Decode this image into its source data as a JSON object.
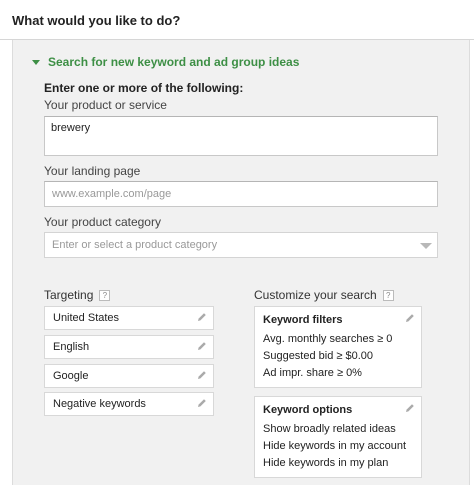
{
  "header": {
    "title": "What would you like to do?"
  },
  "section": {
    "label": "Search for new keyword and ad group ideas"
  },
  "form": {
    "heading": "Enter one or more of the following:",
    "product_label": "Your product or service",
    "product_value": "brewery",
    "landing_label": "Your landing page",
    "landing_placeholder": "www.example.com/page",
    "category_label": "Your product category",
    "category_placeholder": "Enter or select a product category"
  },
  "targeting": {
    "label": "Targeting",
    "help": "?",
    "items": [
      "United States",
      "English",
      "Google",
      "Negative keywords"
    ]
  },
  "customize": {
    "label": "Customize your search",
    "help": "?",
    "filters": {
      "title": "Keyword filters",
      "lines": [
        "Avg. monthly searches ≥ 0",
        "Suggested bid ≥ $0.00",
        "Ad impr. share ≥ 0%"
      ]
    },
    "options": {
      "title": "Keyword options",
      "lines": [
        "Show broadly related ideas",
        "Hide keywords in my account",
        "Hide keywords in my plan"
      ]
    }
  },
  "colors": {
    "accent_green": "#3d8f45",
    "panel_bg": "#f1f1f1"
  },
  "icons": {
    "edit": "pencil-icon",
    "toggle": "triangle-down-icon",
    "help": "help-icon",
    "dropdown": "dropdown-arrow-icon"
  }
}
